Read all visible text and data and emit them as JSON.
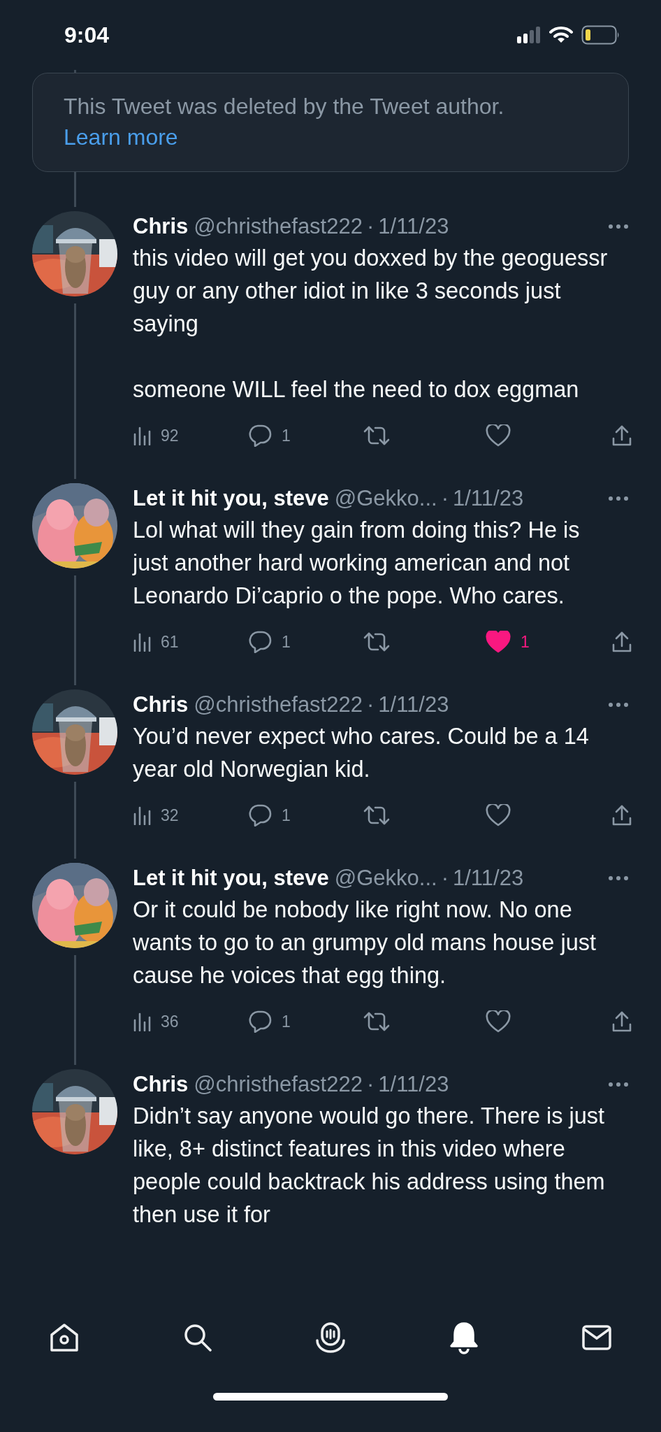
{
  "status_bar": {
    "time": "9:04"
  },
  "deleted_notice": {
    "text": "This Tweet was deleted by the Tweet author.",
    "link": "Learn more"
  },
  "tweets": [
    {
      "name": "Chris",
      "handle": "@christhefast222",
      "separator": "·",
      "date": "1/11/23",
      "paragraphs": [
        "this video will get you doxxed by the geoguessr guy or any other idiot in like 3 seconds just saying",
        "someone WILL feel the need to dox eggman"
      ],
      "views": "92",
      "replies": "1",
      "liked": false
    },
    {
      "name": "Let it hit you, steve",
      "handle": "@Gekko...",
      "separator": "·",
      "date": "1/11/23",
      "paragraphs": [
        "Lol what will they gain from doing this? He is just another hard working american and not Leonardo Di’caprio o the pope. Who cares."
      ],
      "views": "61",
      "replies": "1",
      "liked": true,
      "likes": "1"
    },
    {
      "name": "Chris",
      "handle": "@christhefast222",
      "separator": "·",
      "date": "1/11/23",
      "paragraphs": [
        "You’d never expect who cares. Could be a 14 year old Norwegian kid."
      ],
      "views": "32",
      "replies": "1",
      "liked": false
    },
    {
      "name": "Let it hit you, steve",
      "handle": "@Gekko...",
      "separator": "·",
      "date": "1/11/23",
      "paragraphs": [
        "Or it could be nobody like right now. No one wants to go to an grumpy old mans house just cause he voices that egg thing."
      ],
      "views": "36",
      "replies": "1",
      "liked": false
    },
    {
      "name": "Chris",
      "handle": "@christhefast222",
      "separator": "·",
      "date": "1/11/23",
      "paragraphs": [
        "Didn’t say anyone would go there. There is just like, 8+ distinct features in this video where people could backtrack his address using them then use it for"
      ]
    }
  ],
  "tab_bar": [
    {
      "kind": "home",
      "selected": false
    },
    {
      "kind": "search",
      "selected": false
    },
    {
      "kind": "spaces",
      "selected": false
    },
    {
      "kind": "notifications",
      "selected": true
    },
    {
      "kind": "messages",
      "selected": false
    }
  ]
}
